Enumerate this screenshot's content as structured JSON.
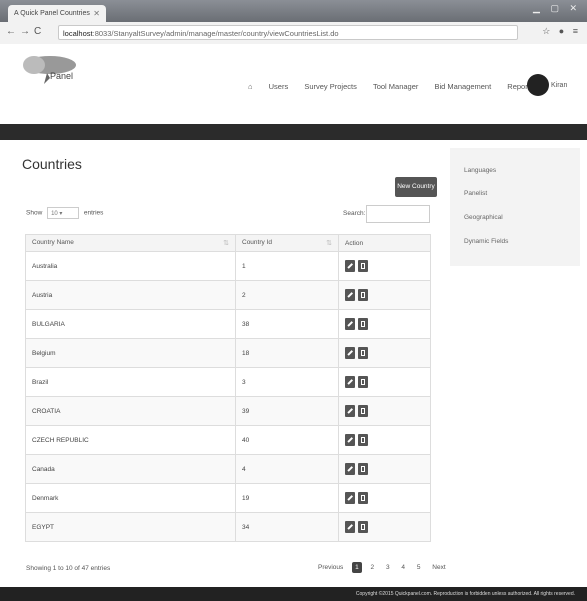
{
  "browser": {
    "tab_title": "A Quick Panel Countries",
    "url_host": "localhost",
    "url_path": ":8033/StanyaltSurvey/admin/manage/master/country/viewCountriesList.do"
  },
  "header": {
    "logo_text": "Panel",
    "nav": [
      "Users",
      "Survey Projects",
      "Tool Manager",
      "Bid Management",
      "Reports"
    ],
    "user_name": "Kiran"
  },
  "page": {
    "title": "Countries",
    "new_button": "New Country",
    "show_label": "Show",
    "show_value": "10",
    "entries_label": "entries",
    "search_label": "Search:"
  },
  "table": {
    "columns": [
      "Country Name",
      "Country Id",
      "Action"
    ],
    "rows": [
      {
        "name": "Australia",
        "id": "1"
      },
      {
        "name": "Austria",
        "id": "2"
      },
      {
        "name": "BULGARIA",
        "id": "38"
      },
      {
        "name": "Belgium",
        "id": "18"
      },
      {
        "name": "Brazil",
        "id": "3"
      },
      {
        "name": "CROATIA",
        "id": "39"
      },
      {
        "name": "CZECH REPUBLIC",
        "id": "40"
      },
      {
        "name": "Canada",
        "id": "4"
      },
      {
        "name": "Denmark",
        "id": "19"
      },
      {
        "name": "EGYPT",
        "id": "34"
      }
    ]
  },
  "pagination": {
    "showing": "Showing 1 to 10 of 47 entries",
    "previous": "Previous",
    "pages": [
      "1",
      "2",
      "3",
      "4",
      "5"
    ],
    "next": "Next"
  },
  "sidebar": {
    "items": [
      "Languages",
      "Panelist",
      "Geographical",
      "Dynamic Fields"
    ]
  },
  "footer": {
    "copyright": "Copyright ©2015 Quickpanel.com. Reproduction is forbidden unless authorized. All rights reserved."
  }
}
